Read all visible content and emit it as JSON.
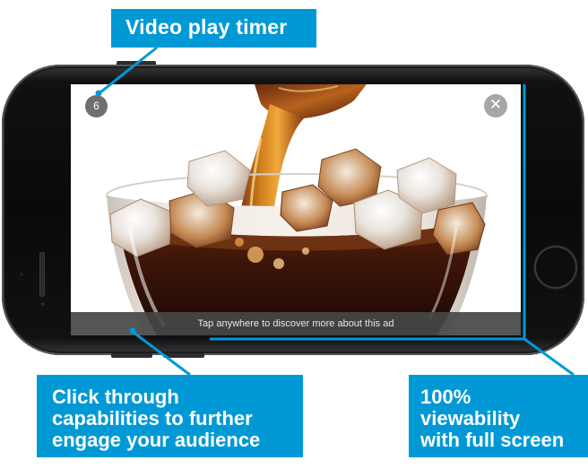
{
  "callouts": {
    "timer": "Video play timer",
    "click_through": [
      "Click through",
      "capabilities to further",
      "engage your audience"
    ],
    "viewability": [
      "100%",
      "viewability",
      "with full screen"
    ]
  },
  "ad": {
    "timer_value": "6",
    "close_icon": "close-icon",
    "cta_text": "Tap anywhere to discover more about this ad"
  },
  "colors": {
    "callout_blue": "#0099d6",
    "phone_body": "#0a0a0b",
    "cta_bar": "#464646"
  }
}
